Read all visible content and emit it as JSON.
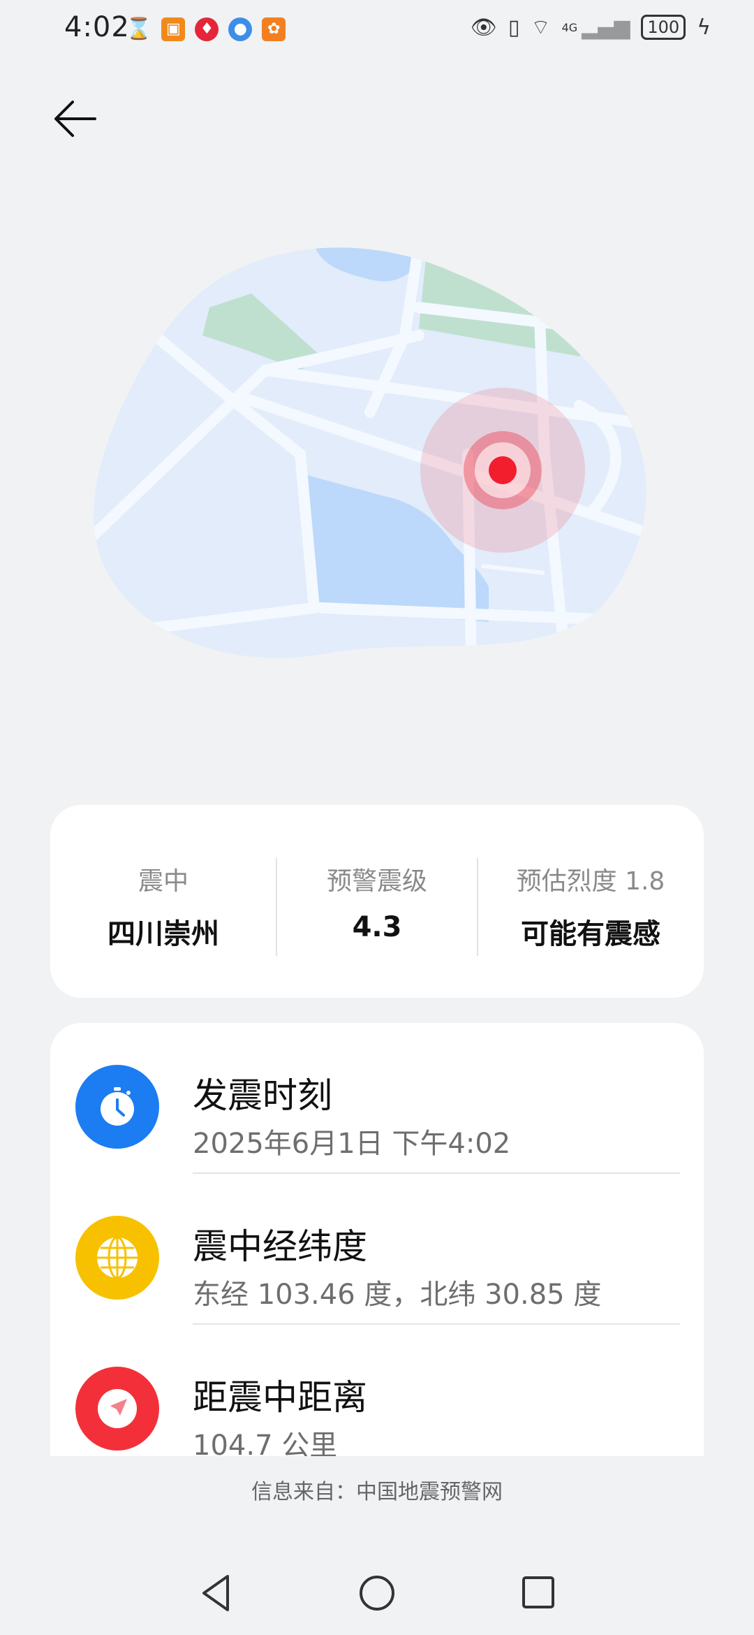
{
  "status": {
    "time": "4:02",
    "network": "4G",
    "battery": "100"
  },
  "summary": {
    "epicenter_label": "震中",
    "epicenter_value": "四川崇州",
    "magnitude_label": "预警震级",
    "magnitude_value": "4.3",
    "intensity_label": "预估烈度 1.8",
    "intensity_value": "可能有震感"
  },
  "details": [
    {
      "title": "发震时刻",
      "value": "2025年6月1日 下午4:02",
      "icon": "clock-icon",
      "color": "#1c7cf2"
    },
    {
      "title": "震中经纬度",
      "value": "东经 103.46 度，北纬 30.85 度",
      "icon": "globe-icon",
      "color": "#f7c100"
    },
    {
      "title": "距震中距离",
      "value": "104.7 公里",
      "icon": "navigation-arrow-icon",
      "color": "#f3303a"
    }
  ],
  "footer": {
    "source": "信息来自：中国地震预警网"
  },
  "colors": {
    "background": "#f1f2f4",
    "map_land": "#e2ecfa",
    "map_water": "#bcd8fa",
    "map_park": "#bfe0cf",
    "alert_red": "#f21d2d"
  }
}
